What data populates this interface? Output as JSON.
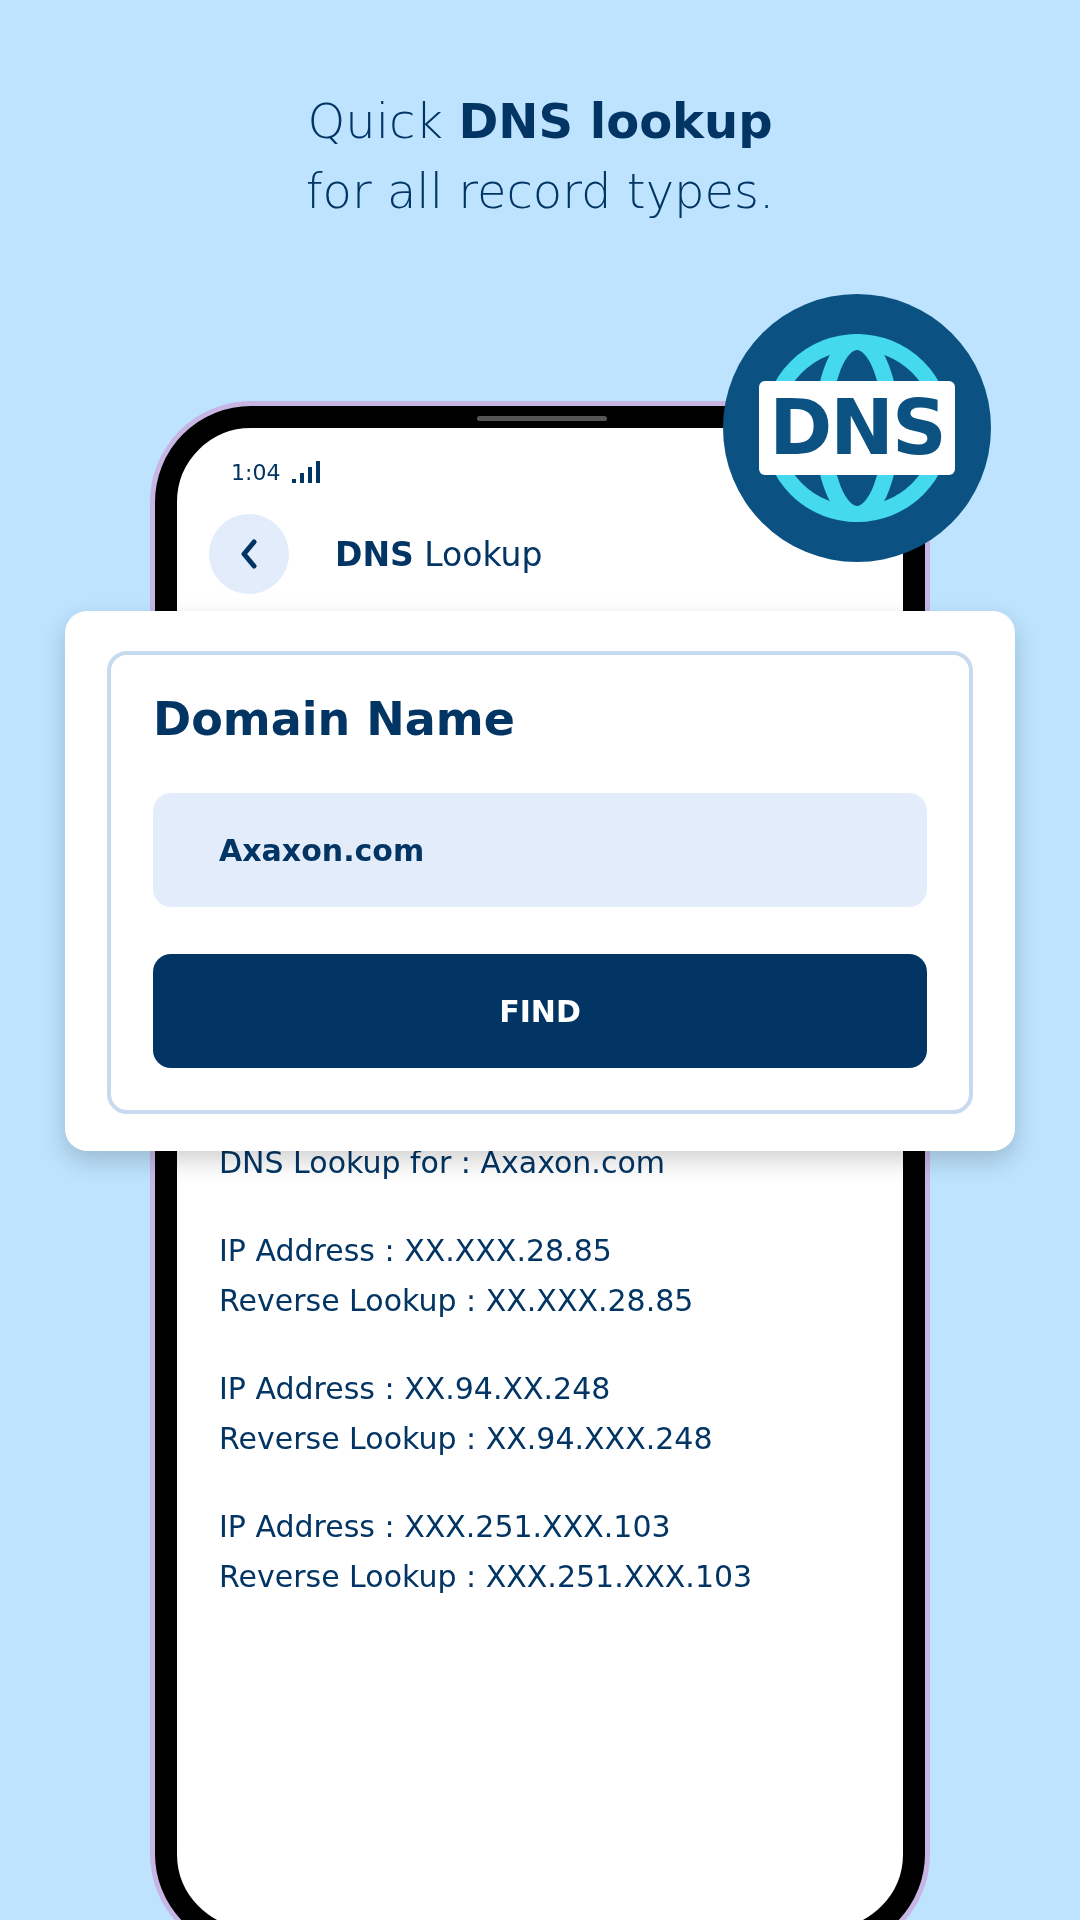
{
  "headline": [
    "Quick **DNS lookup**",
    "for all record types."
  ],
  "badge": {
    "text": "DNS"
  },
  "status_bar": {
    "time": "1:04"
  },
  "app_bar": {
    "title": "**DNS** Lookup"
  },
  "card": {
    "label": "Domain Name",
    "field": {
      "value": "Axaxon.com"
    },
    "button": "FIND"
  },
  "results": {
    "heading": "DNS Lookup for : Axaxon.com",
    "records": [
      {
        "ip": "IP Address : XX.XXX.28.85",
        "reverse": "Reverse Lookup : XX.XXX.28.85"
      },
      {
        "ip": "IP Address : XX.94.XX.248",
        "reverse": "Reverse Lookup : XX.94.XXX.248"
      },
      {
        "ip": "IP Address : XXX.251.XXX.103",
        "reverse": "Reverse Lookup : XXX.251.XXX.103"
      }
    ]
  }
}
